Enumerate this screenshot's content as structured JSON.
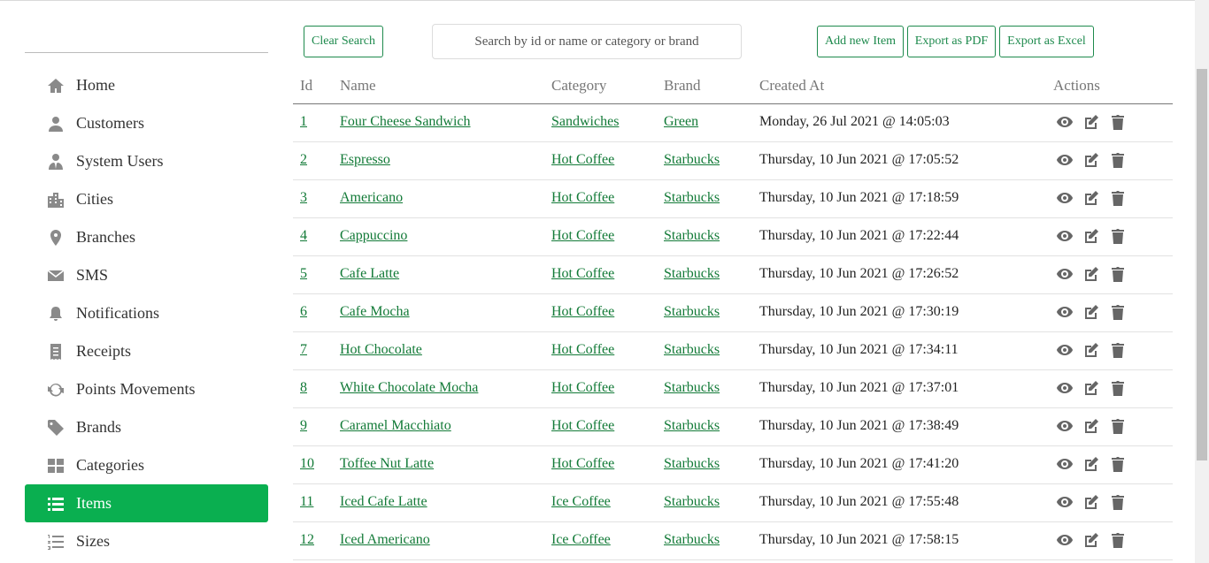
{
  "sidebar": {
    "items": [
      {
        "label": "Home",
        "icon": "home-icon"
      },
      {
        "label": "Customers",
        "icon": "user-icon"
      },
      {
        "label": "System Users",
        "icon": "user-tie-icon"
      },
      {
        "label": "Cities",
        "icon": "city-icon"
      },
      {
        "label": "Branches",
        "icon": "map-marker-icon"
      },
      {
        "label": "SMS",
        "icon": "envelope-icon"
      },
      {
        "label": "Notifications",
        "icon": "bell-icon"
      },
      {
        "label": "Receipts",
        "icon": "receipt-icon"
      },
      {
        "label": "Points Movements",
        "icon": "sync-icon"
      },
      {
        "label": "Brands",
        "icon": "tag-icon"
      },
      {
        "label": "Categories",
        "icon": "grid-icon"
      },
      {
        "label": "Items",
        "icon": "list-icon",
        "active": true
      },
      {
        "label": "Sizes",
        "icon": "list-ol-icon"
      }
    ]
  },
  "toolbar": {
    "clear_search": "Clear Search",
    "search_placeholder": "Search by id or name or category or brand",
    "add_item": "Add new Item",
    "export_pdf": "Export as PDF",
    "export_excel": "Export as Excel"
  },
  "table": {
    "headers": {
      "id": "Id",
      "name": "Name",
      "category": "Category",
      "brand": "Brand",
      "created": "Created At",
      "actions": "Actions"
    },
    "rows": [
      {
        "id": "1",
        "name": "Four Cheese Sandwich",
        "category": "Sandwiches",
        "brand": "Green",
        "created": "Monday, 26 Jul 2021 @ 14:05:03"
      },
      {
        "id": "2",
        "name": "Espresso",
        "category": "Hot Coffee",
        "brand": "Starbucks",
        "created": "Thursday, 10 Jun 2021 @ 17:05:52"
      },
      {
        "id": "3",
        "name": "Americano",
        "category": "Hot Coffee",
        "brand": "Starbucks",
        "created": "Thursday, 10 Jun 2021 @ 17:18:59"
      },
      {
        "id": "4",
        "name": "Cappuccino",
        "category": "Hot Coffee",
        "brand": "Starbucks",
        "created": "Thursday, 10 Jun 2021 @ 17:22:44"
      },
      {
        "id": "5",
        "name": "Cafe Latte",
        "category": "Hot Coffee",
        "brand": "Starbucks",
        "created": "Thursday, 10 Jun 2021 @ 17:26:52"
      },
      {
        "id": "6",
        "name": "Cafe Mocha",
        "category": "Hot Coffee",
        "brand": "Starbucks",
        "created": "Thursday, 10 Jun 2021 @ 17:30:19"
      },
      {
        "id": "7",
        "name": "Hot Chocolate",
        "category": "Hot Coffee",
        "brand": "Starbucks",
        "created": "Thursday, 10 Jun 2021 @ 17:34:11"
      },
      {
        "id": "8",
        "name": "White Chocolate Mocha",
        "category": "Hot Coffee",
        "brand": "Starbucks",
        "created": "Thursday, 10 Jun 2021 @ 17:37:01"
      },
      {
        "id": "9",
        "name": "Caramel Macchiato",
        "category": "Hot Coffee",
        "brand": "Starbucks",
        "created": "Thursday, 10 Jun 2021 @ 17:38:49"
      },
      {
        "id": "10",
        "name": "Toffee Nut Latte",
        "category": "Hot Coffee",
        "brand": "Starbucks",
        "created": "Thursday, 10 Jun 2021 @ 17:41:20"
      },
      {
        "id": "11",
        "name": "Iced Cafe Latte",
        "category": "Ice Coffee",
        "brand": "Starbucks",
        "created": "Thursday, 10 Jun 2021 @ 17:55:48"
      },
      {
        "id": "12",
        "name": "Iced Americano",
        "category": "Ice Coffee",
        "brand": "Starbucks",
        "created": "Thursday, 10 Jun 2021 @ 17:58:15"
      }
    ]
  },
  "colors": {
    "accent": "#0aaf50",
    "link": "#127a37",
    "button_border": "#1e8a4d"
  }
}
